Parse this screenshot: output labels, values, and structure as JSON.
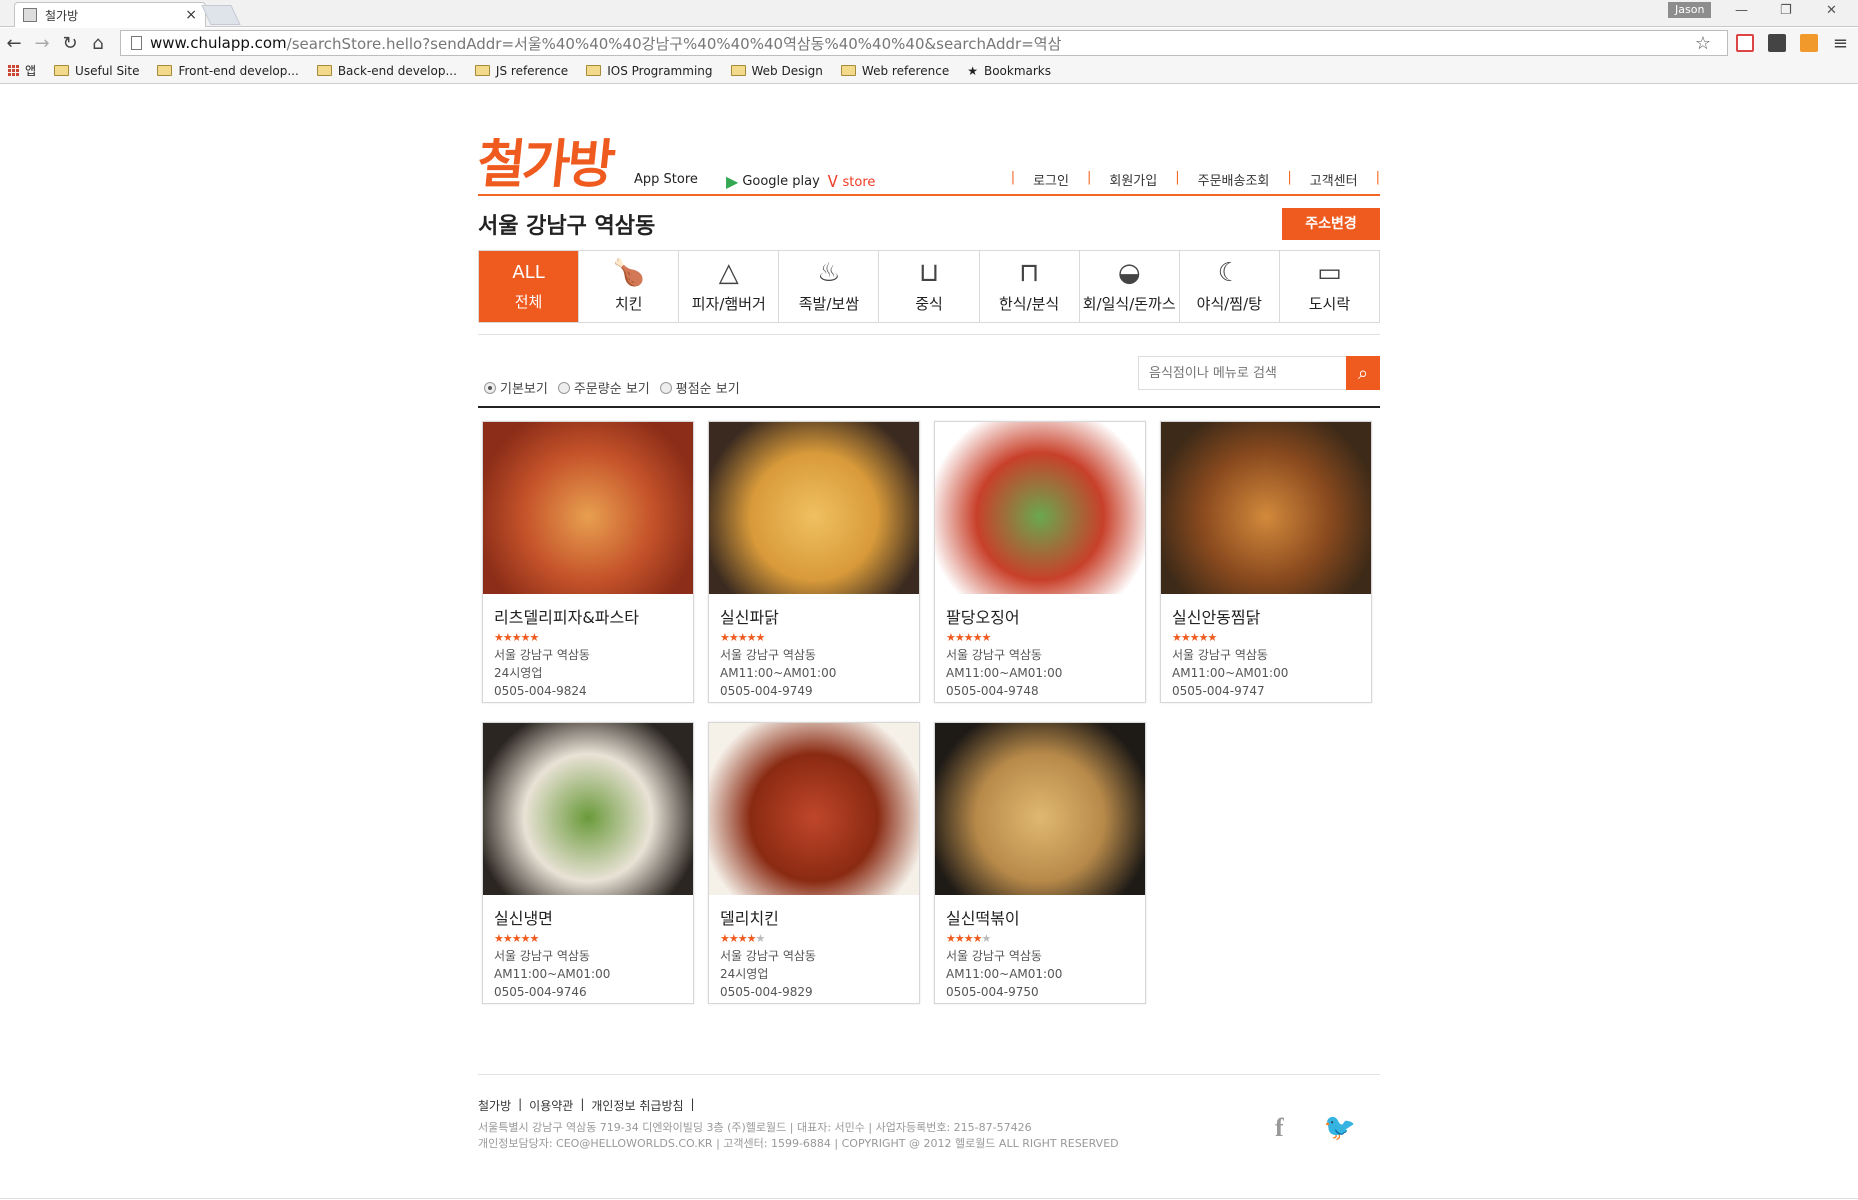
{
  "browser": {
    "tab_title": "철가방",
    "profile": "Jason",
    "url_host": "www.chulapp.com",
    "url_path": "/searchStore.hello?sendAddr=서울%40%40%40강남구%40%40%40역삼동%40%40%40&searchAddr=역삼",
    "bookmarks": [
      "앱",
      "Useful Site",
      "Front-end develop...",
      "Back-end develop...",
      "JS reference",
      "IOS Programming",
      "Web Design",
      "Web reference",
      "Bookmarks"
    ]
  },
  "header": {
    "logo": "철가방",
    "stores": [
      "App Store",
      "Google play",
      "store"
    ],
    "nav": [
      "로그인",
      "회원가입",
      "주문배송조회",
      "고객센터"
    ],
    "location": "서울 강남구 역삼동",
    "address_button": "주소변경"
  },
  "categories": [
    {
      "label": "전체",
      "top": "ALL",
      "icon": "all-icon"
    },
    {
      "label": "치킨",
      "icon": "chicken-icon"
    },
    {
      "label": "피자/햄버거",
      "icon": "pizza-icon"
    },
    {
      "label": "족발/보쌈",
      "icon": "pork-icon"
    },
    {
      "label": "중식",
      "icon": "chinese-icon"
    },
    {
      "label": "한식/분식",
      "icon": "korean-icon"
    },
    {
      "label": "회/일식/돈까스",
      "icon": "fish-icon"
    },
    {
      "label": "야식/찜/탕",
      "icon": "night-icon"
    },
    {
      "label": "도시락",
      "icon": "lunchbox-icon"
    }
  ],
  "sort": {
    "options": [
      "기본보기",
      "주문량순 보기",
      "평점순 보기"
    ],
    "selected": 0,
    "search_placeholder": "음식점이나 메뉴로 검색"
  },
  "stores": [
    {
      "name": "리츠델리피자&파스타",
      "rating": 5,
      "area": "서울 강남구 역삼동",
      "hours": "24시영업",
      "phone": "0505-004-9824",
      "food": "pizza"
    },
    {
      "name": "실신파닭",
      "rating": 5,
      "area": "서울 강남구 역삼동",
      "hours": "AM11:00~AM01:00",
      "phone": "0505-004-9749",
      "food": "fried"
    },
    {
      "name": "팔당오징어",
      "rating": 5,
      "area": "서울 강남구 역삼동",
      "hours": "AM11:00~AM01:00",
      "phone": "0505-004-9748",
      "food": "spicy"
    },
    {
      "name": "실신안동찜닭",
      "rating": 5,
      "area": "서울 강남구 역삼동",
      "hours": "AM11:00~AM01:00",
      "phone": "0505-004-9747",
      "food": "braised"
    },
    {
      "name": "실신냉면",
      "rating": 5,
      "area": "서울 강남구 역삼동",
      "hours": "AM11:00~AM01:00",
      "phone": "0505-004-9746",
      "food": "soup"
    },
    {
      "name": "델리치킨",
      "rating": 4,
      "area": "서울 강남구 역삼동",
      "hours": "24시영업",
      "phone": "0505-004-9829",
      "food": "glazed"
    },
    {
      "name": "실신떡볶이",
      "rating": 4,
      "area": "서울 강남구 역삼동",
      "hours": "AM11:00~AM01:00",
      "phone": "0505-004-9750",
      "food": "stew"
    }
  ],
  "footer": {
    "links": [
      "철가방",
      "이용약관",
      "개인정보 취급방침"
    ],
    "address": "서울특별시 강남구 역삼동 719-34 디엔와이빌딩 3층 (주)헬로월드 | 대표자: 서민수 | 사업자등록번호: 215-87-57426",
    "contact": "개인정보담당자: CEO@HELLOWORLDS.CO.KR | 고객센터: 1599-6884 | COPYRIGHT @ 2012 헬로월드 ALL RIGHT RESERVED"
  },
  "colors": {
    "accent": "#ef5a1f",
    "star": "#ef5a1f"
  }
}
